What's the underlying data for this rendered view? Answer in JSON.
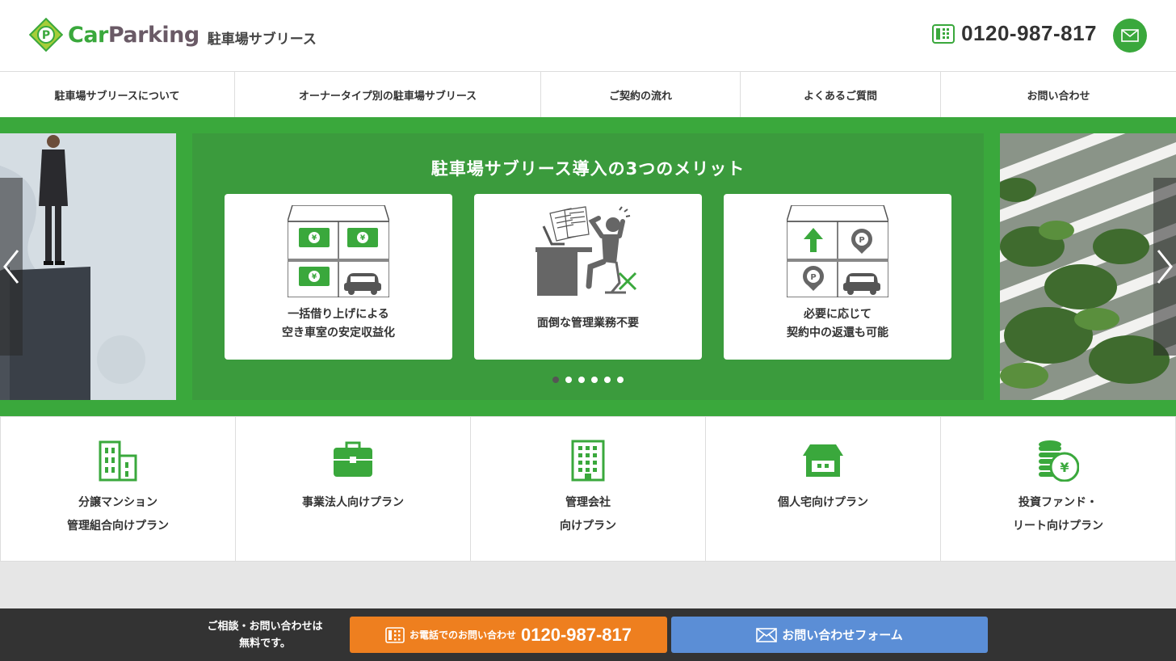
{
  "header": {
    "logo_car": "Car",
    "logo_parking": "Parking",
    "logo_subtitle": "駐車場サブリース",
    "phone": "0120-987-817",
    "mail_icon": "mail-icon"
  },
  "nav": {
    "items": [
      {
        "label": "駐車場サブリースについて"
      },
      {
        "label": "オーナータイプ別の駐車場サブリース"
      },
      {
        "label": "ご契約の流れ"
      },
      {
        "label": "よくあるご質問"
      },
      {
        "label": "お問い合わせ"
      }
    ]
  },
  "hero": {
    "title": "駐車場サブリース導入の3つのメリット",
    "cards": [
      {
        "line1": "一括借り上げによる",
        "line2": "空き車室の安定収益化",
        "icon": "money-parking-icon"
      },
      {
        "line1": "面倒な管理業務不要",
        "line2": "",
        "icon": "stressed-worker-icon"
      },
      {
        "line1": "必要に応じて",
        "line2": "契約中の返還も可能",
        "icon": "parking-return-icon"
      }
    ],
    "dots_count": 6,
    "active_dot": 0
  },
  "plans": {
    "items": [
      {
        "line1": "分譲マンション",
        "line2": "管理組合向けプラン",
        "icon": "apartment-icon"
      },
      {
        "line1": "事業法人向けプラン",
        "line2": "",
        "icon": "briefcase-icon"
      },
      {
        "line1": "管理会社",
        "line2": "向けプラン",
        "icon": "office-building-icon"
      },
      {
        "line1": "個人宅向けプラン",
        "line2": "",
        "icon": "house-icon"
      },
      {
        "line1": "投資ファンド・",
        "line2": "リート向けプラン",
        "icon": "yen-coins-icon"
      }
    ]
  },
  "footer": {
    "note_line1": "ご相談・お問い合わせは",
    "note_line2": "無料です。",
    "tel_label": "お電話でのお問い合わせ",
    "tel_number": "0120-987-817",
    "form_label": "お問い合わせフォーム"
  },
  "colors": {
    "brand_green": "#3aa83c",
    "slide_green": "#3b9b3d",
    "tel_orange": "#ee7f1f",
    "form_blue": "#5b8ed6",
    "footer_dark": "#333333"
  }
}
